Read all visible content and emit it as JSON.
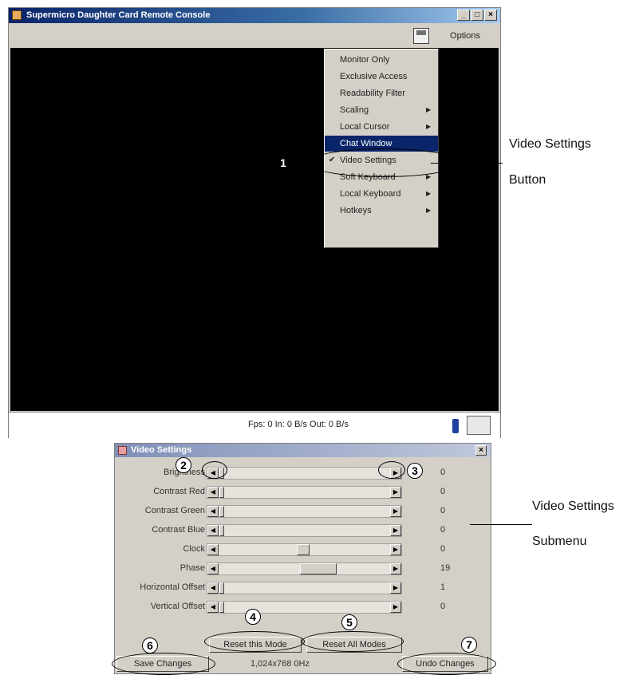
{
  "console": {
    "title": "Supermicro Daughter Card Remote Console",
    "minimize": "_",
    "maximize": "□",
    "close": "×",
    "options_label": "Options",
    "status_text": "Fps: 0 In: 0 B/s Out: 0 B/s"
  },
  "options_menu": {
    "items": [
      {
        "label": "Monitor Only",
        "submenu": false,
        "checked": false,
        "selected": false
      },
      {
        "label": "Exclusive Access",
        "submenu": false,
        "checked": false,
        "selected": false
      },
      {
        "label": "Readability Filter",
        "submenu": false,
        "checked": false,
        "selected": false
      },
      {
        "label": "Scaling",
        "submenu": true,
        "checked": false,
        "selected": false
      },
      {
        "label": "Local Cursor",
        "submenu": true,
        "checked": false,
        "selected": false
      },
      {
        "label": "Chat Window",
        "submenu": false,
        "checked": false,
        "selected": true
      },
      {
        "label": "Video Settings",
        "submenu": false,
        "checked": true,
        "selected": false
      },
      {
        "label": "Soft Keyboard",
        "submenu": true,
        "checked": false,
        "selected": false
      },
      {
        "label": "Local Keyboard",
        "submenu": true,
        "checked": false,
        "selected": false
      },
      {
        "label": "Hotkeys",
        "submenu": true,
        "checked": false,
        "selected": false
      }
    ],
    "arrow": "▶",
    "check": "✔"
  },
  "annotations": {
    "video_settings_button_line1": "Video Settings",
    "video_settings_button_line2": "Button",
    "video_settings_submenu_line1": "Video Settings",
    "video_settings_submenu_line2": "Submenu",
    "n1": "1",
    "n2": "2",
    "n3": "3",
    "n4": "4",
    "n5": "5",
    "n6": "6",
    "n7": "7"
  },
  "video_settings": {
    "title": "Video Settings",
    "close": "×",
    "sliders": [
      {
        "label": "Brightness",
        "value": "0",
        "thumb": null
      },
      {
        "label": "Contrast Red",
        "value": "0",
        "thumb": null
      },
      {
        "label": "Contrast Green",
        "value": "0",
        "thumb": null
      },
      {
        "label": "Contrast Blue",
        "value": "0",
        "thumb": null
      },
      {
        "label": "Clock",
        "value": "0",
        "thumb": "clock"
      },
      {
        "label": "Phase",
        "value": "19",
        "thumb": "phase"
      },
      {
        "label": "Horizontal Offset",
        "value": "1",
        "thumb": null
      },
      {
        "label": "Vertical Offset",
        "value": "0",
        "thumb": null
      }
    ],
    "left_arrow": "◀",
    "right_arrow": "▶",
    "reset_this_mode": "Reset this Mode",
    "reset_all_modes": "Reset All Modes",
    "save_changes": "Save Changes",
    "undo_changes": "Undo Changes",
    "resolution": "1,024x768 0Hz"
  }
}
